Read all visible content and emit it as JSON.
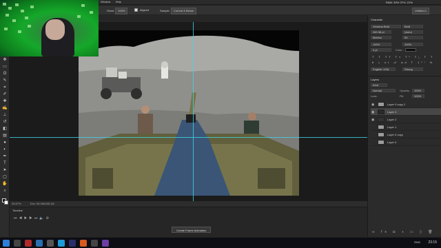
{
  "menubar": {
    "items": [
      "Window",
      "Help"
    ]
  },
  "system_stats": "RAM: 32%   CPU: 21%",
  "options_bar": {
    "show_label": "Show:",
    "show_value": "100%",
    "aligned_checkbox": {
      "label": "Aligned",
      "checked": true
    },
    "sample_label": "Sample:",
    "sample_value": "Current & Below",
    "doc_dropdown": "Untitled-1"
  },
  "status_bar": {
    "zoom": "26.67%",
    "doc_info": "Doc: 96.0M/285.1M"
  },
  "timeline": {
    "title": "Timeline",
    "create_button": "Create Frame Animation"
  },
  "character_panel": {
    "title": "Character",
    "font_family": "Verdana Bold",
    "font_style": "Bold",
    "font_size": "260.38 pt",
    "leading": "(Auto)",
    "kerning": "Metrics",
    "tracking": "50",
    "vertical_scale": "100%",
    "horizontal_scale": "100%",
    "baseline": "0 pt",
    "color_label": "Color:",
    "language": "English: USA",
    "antialias": "Strong"
  },
  "layers_panel": {
    "title": "Layers",
    "kind_filter": "Kind",
    "blend_mode": "Normal",
    "opacity_label": "Opacity:",
    "opacity": "100%",
    "lock_label": "Lock:",
    "fill_label": "Fill:",
    "fill": "100%",
    "layers": [
      {
        "name": "Layer 0 copy 2",
        "selected": false,
        "visible": true
      },
      {
        "name": "Layer 3",
        "selected": true,
        "visible": true
      },
      {
        "name": "Layer 2",
        "selected": false,
        "visible": true
      },
      {
        "name": "Layer 1",
        "selected": false,
        "visible": false
      },
      {
        "name": "Layer 0 copy",
        "selected": false,
        "visible": false
      },
      {
        "name": "Layer 0",
        "selected": false,
        "visible": false
      }
    ]
  },
  "taskbar": {
    "language": "ENG",
    "time": "23:15"
  },
  "colors": {
    "webcam_green": "#15a82a",
    "guide_cyan": "#3fd8e6",
    "selection_layer": "#474747",
    "canvas_bg": "#1b1b1b",
    "panel_bg": "#2b2b2b"
  }
}
